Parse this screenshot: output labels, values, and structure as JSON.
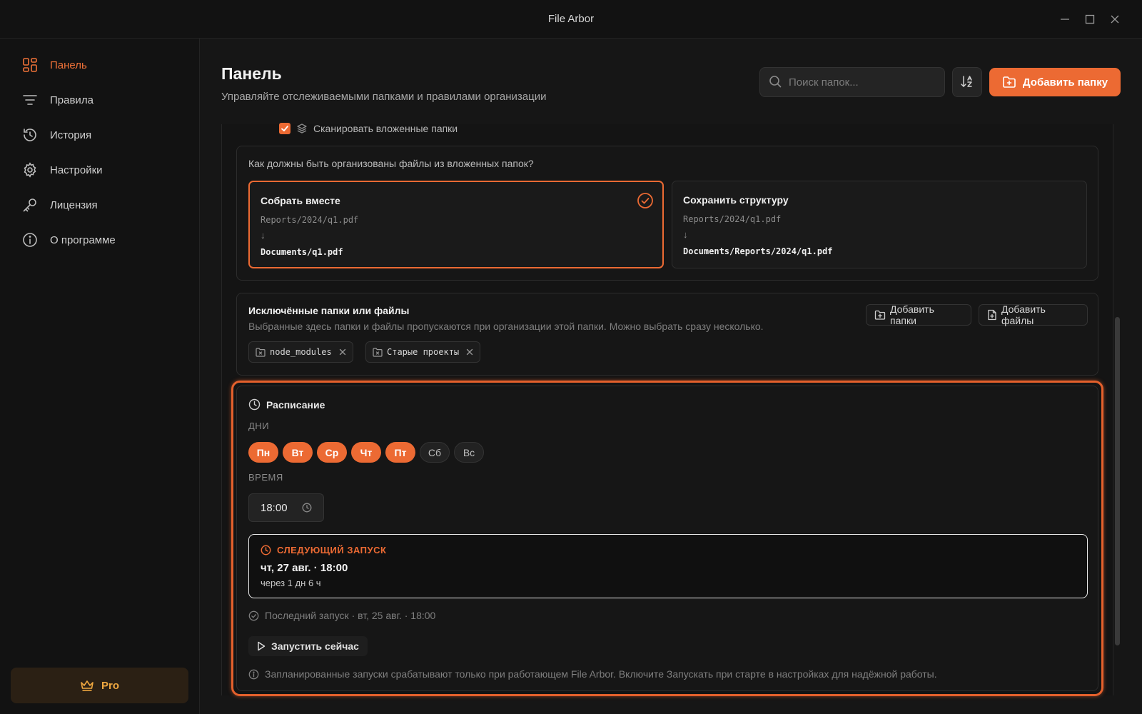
{
  "window": {
    "title": "File Arbor"
  },
  "sidebar": {
    "items": [
      {
        "label": "Панель",
        "icon": "dashboard-icon",
        "active": true
      },
      {
        "label": "Правила",
        "icon": "filter-icon",
        "active": false
      },
      {
        "label": "История",
        "icon": "history-icon",
        "active": false
      },
      {
        "label": "Настройки",
        "icon": "gear-icon",
        "active": false
      },
      {
        "label": "Лицензия",
        "icon": "key-icon",
        "active": false
      },
      {
        "label": "О программе",
        "icon": "info-icon",
        "active": false
      }
    ],
    "pro_label": "Pro"
  },
  "header": {
    "title": "Панель",
    "subtitle": "Управляйте отслеживаемыми папками и правилами организации",
    "search_placeholder": "Поиск папок...",
    "add_folder_label": "Добавить папку"
  },
  "folder_settings": {
    "scan_subfolders_label": "Сканировать вложенные папки",
    "scan_subfolders_checked": true,
    "organize_question": "Как должны быть организованы файлы из вложенных папок?",
    "options": [
      {
        "title": "Собрать вместе",
        "source": "Reports/2024/q1.pdf",
        "arrow": "↓",
        "destination": "Documents/q1.pdf",
        "selected": true
      },
      {
        "title": "Сохранить структуру",
        "source": "Reports/2024/q1.pdf",
        "arrow": "↓",
        "destination": "Documents/Reports/2024/q1.pdf",
        "selected": false
      }
    ]
  },
  "exclusions": {
    "title": "Исключённые папки или файлы",
    "description": "Выбранные здесь папки и файлы пропускаются при организации этой папки. Можно выбрать сразу несколько.",
    "add_folders_label": "Добавить папки",
    "add_files_label": "Добавить файлы",
    "items": [
      "node_modules",
      "Старые проекты"
    ]
  },
  "schedule": {
    "title": "Расписание",
    "days_label": "ДНИ",
    "days": [
      {
        "label": "Пн",
        "on": true
      },
      {
        "label": "Вт",
        "on": true
      },
      {
        "label": "Ср",
        "on": true
      },
      {
        "label": "Чт",
        "on": true
      },
      {
        "label": "Пт",
        "on": true
      },
      {
        "label": "Сб",
        "on": false
      },
      {
        "label": "Вс",
        "on": false
      }
    ],
    "time_label": "ВРЕМЯ",
    "time_value": "18:00",
    "next_run_label": "СЛЕДУЮЩИЙ ЗАПУСК",
    "next_run_date": "чт, 27 авг. · 18:00",
    "next_run_relative": "через 1 дн 6 ч",
    "last_run": "Последний запуск · вт, 25 авг. · 18:00",
    "run_now_label": "Запустить сейчас",
    "note": "Запланированные запуски срабатывают только при работающем File Arbor. Включите Запускать при старте в настройках для надёжной работы."
  },
  "colors": {
    "accent": "#ec6a33",
    "background": "#161616",
    "pro_text": "#f0a840"
  }
}
